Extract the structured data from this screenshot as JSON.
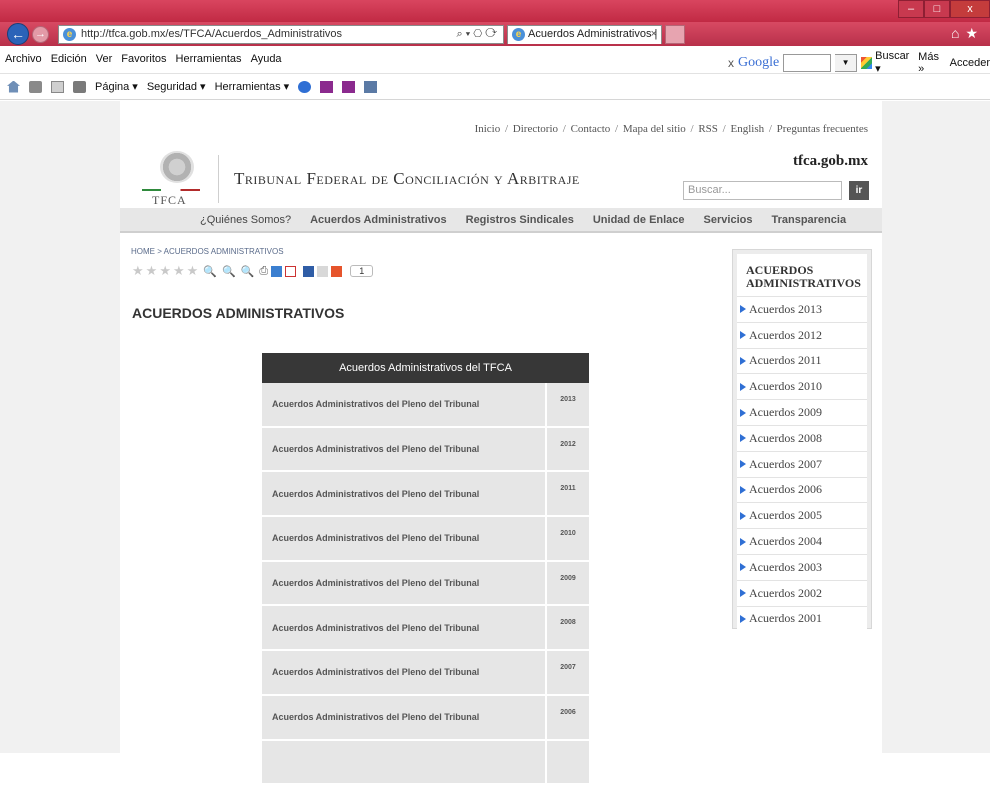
{
  "browser": {
    "url": "http://tfca.gob.mx/es/TFCA/Acuerdos_Administrativos",
    "url_tools": "⌕ ▾ ⎔ ⟳",
    "tab_title": "Acuerdos Administrativos | ...",
    "menu": [
      "Archivo",
      "Edición",
      "Ver",
      "Favoritos",
      "Herramientas",
      "Ayuda"
    ],
    "google": {
      "close": "x",
      "logo": "Google",
      "buscar": "Buscar ▾",
      "mas": "Más »",
      "acceder": "Acceder"
    },
    "commands": [
      "Página ▾",
      "Seguridad ▾",
      "Herramientas ▾"
    ]
  },
  "site": {
    "top_links": [
      "Inicio",
      "Directorio",
      "Contacto",
      "Mapa del sitio",
      "RSS",
      "English",
      "Preguntas frecuentes"
    ],
    "logo_label": "TFCA",
    "title": "Tribunal Federal de Conciliación y Arbitraje",
    "domain": "tfca.gob.mx",
    "search_placeholder": "Buscar...",
    "search_button": "ir",
    "nav": [
      "¿Quiénes Somos?",
      "Acuerdos Administrativos",
      "Registros Sindicales",
      "Unidad de Enlace",
      "Servicios",
      "Transparencia"
    ]
  },
  "content": {
    "breadcrumb": "HOME > ACUERDOS ADMINISTRATIVOS",
    "share_count": "1",
    "page_title": "ACUERDOS ADMINISTRATIVOS",
    "table": {
      "header": "Acuerdos Administrativos del TFCA",
      "rows": [
        {
          "desc": "Acuerdos Administrativos del Pleno del Tribunal",
          "year": "2013"
        },
        {
          "desc": "Acuerdos Administrativos del Pleno del Tribunal",
          "year": "2012"
        },
        {
          "desc": "Acuerdos Administrativos del Pleno del Tribunal",
          "year": "2011"
        },
        {
          "desc": "Acuerdos Administrativos del Pleno del Tribunal",
          "year": "2010"
        },
        {
          "desc": "Acuerdos Administrativos del Pleno del Tribunal",
          "year": "2009"
        },
        {
          "desc": "Acuerdos Administrativos del Pleno del Tribunal",
          "year": "2008"
        },
        {
          "desc": "Acuerdos Administrativos del Pleno del Tribunal",
          "year": "2007"
        },
        {
          "desc": "Acuerdos Administrativos del Pleno del Tribunal",
          "year": "2006"
        },
        {
          "desc": "",
          "year": ""
        }
      ]
    }
  },
  "sidebar": {
    "title": "ACUERDOS ADMINISTRATIVOS",
    "items": [
      "Acuerdos 2013",
      "Acuerdos 2012",
      "Acuerdos 2011",
      "Acuerdos 2010",
      "Acuerdos 2009",
      "Acuerdos 2008",
      "Acuerdos 2007",
      "Acuerdos 2006",
      "Acuerdos 2005",
      "Acuerdos 2004",
      "Acuerdos 2003",
      "Acuerdos 2002",
      "Acuerdos 2001"
    ]
  }
}
